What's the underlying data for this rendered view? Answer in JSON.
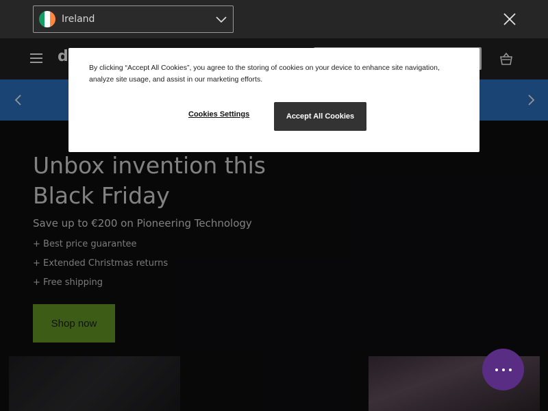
{
  "country_bar": {
    "selected_country": "Ireland",
    "flag_colors": [
      "#169b62",
      "#ffffff",
      "#ff883e"
    ]
  },
  "header": {
    "logo_text": "d",
    "icons": [
      "menu-icon",
      "basket-icon"
    ]
  },
  "promo_bar": {
    "color": "#2869b3"
  },
  "hero": {
    "title": "Unbox invention this Black Friday",
    "subtitle": "Save up to €200 on Pioneering Technology",
    "benefits": [
      "+ Best price guarantee",
      "+ Extended Christmas returns",
      "+ Free shipping"
    ],
    "cta_label": "Shop now",
    "cta_color": "#5f8f22"
  },
  "cookie_dialog": {
    "text": "By clicking “Accept All Cookies”, you agree to the storing of cookies on your device to enhance site navigation, analyze site usage, and assist in our marketing efforts.",
    "settings_label": "Cookies Settings",
    "accept_label": "Accept All Cookies"
  },
  "chat": {
    "color": "#5a2d84"
  }
}
